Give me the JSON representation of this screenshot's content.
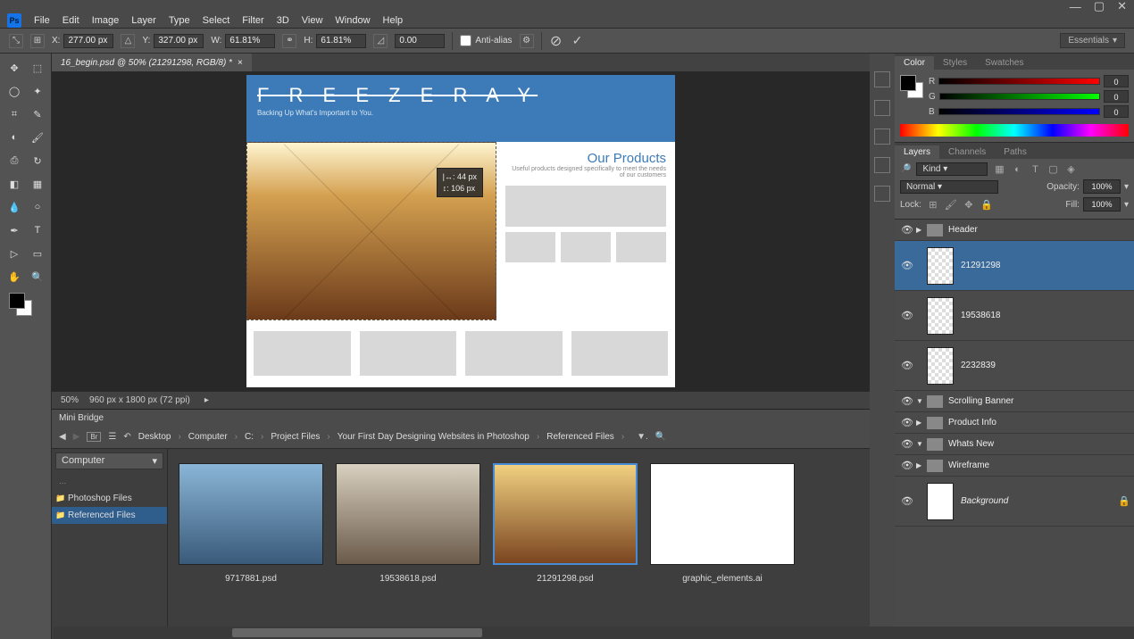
{
  "menu": {
    "items": [
      "File",
      "Edit",
      "Image",
      "Layer",
      "Type",
      "Select",
      "Filter",
      "3D",
      "View",
      "Window",
      "Help"
    ]
  },
  "options": {
    "x": "277.00 px",
    "y": "327.00 px",
    "w": "61.81%",
    "h": "61.81%",
    "angle": "0.00",
    "antialias": "Anti-alias",
    "workspace": "Essentials"
  },
  "tab": {
    "name": "16_begin.psd @ 50% (21291298, RGB/8) *"
  },
  "canvas": {
    "logo": "F R E E Z E  R A Y",
    "tagline": "Backing Up What's Important to You.",
    "products_title": "Our Products",
    "products_desc": "Useful products designed specifically to meet the needs of our customers",
    "measure_w": "44 px",
    "measure_h": "106 px"
  },
  "status": {
    "zoom": "50%",
    "dims": "960 px x 1800 px (72 ppi)"
  },
  "minibridge": {
    "title": "Mini Bridge",
    "dd": "Computer",
    "crumbs": [
      "Desktop",
      "Computer",
      "C:",
      "Project Files",
      "Your First Day Designing Websites in Photoshop",
      "Referenced Files"
    ],
    "folders": [
      "Photoshop Files",
      "Referenced Files"
    ],
    "thumbs": [
      {
        "name": "9717881.psd",
        "sel": false
      },
      {
        "name": "19538618.psd",
        "sel": false
      },
      {
        "name": "21291298.psd",
        "sel": true
      },
      {
        "name": "graphic_elements.ai",
        "sel": false
      }
    ]
  },
  "panels": {
    "color_tabs": [
      "Color",
      "Styles",
      "Swatches"
    ],
    "rgb": {
      "r": "0",
      "g": "0",
      "b": "0"
    },
    "layer_tabs": [
      "Layers",
      "Channels",
      "Paths"
    ],
    "filter": "Kind",
    "blend": "Normal",
    "opacity": "100%",
    "fill": "100%",
    "lock_label": "Lock:",
    "opacity_label": "Opacity:",
    "fill_label": "Fill:"
  },
  "layers": [
    {
      "t": "group",
      "name": "Header",
      "open": false
    },
    {
      "t": "layer",
      "name": "21291298",
      "sel": true
    },
    {
      "t": "layer",
      "name": "19538618"
    },
    {
      "t": "layer",
      "name": "2232839"
    },
    {
      "t": "group",
      "name": "Scrolling Banner",
      "open": true
    },
    {
      "t": "group",
      "name": "Product Info",
      "open": false
    },
    {
      "t": "group",
      "name": "Whats New",
      "open": true
    },
    {
      "t": "group",
      "name": "Wireframe",
      "open": false
    },
    {
      "t": "bg",
      "name": "Background"
    }
  ]
}
